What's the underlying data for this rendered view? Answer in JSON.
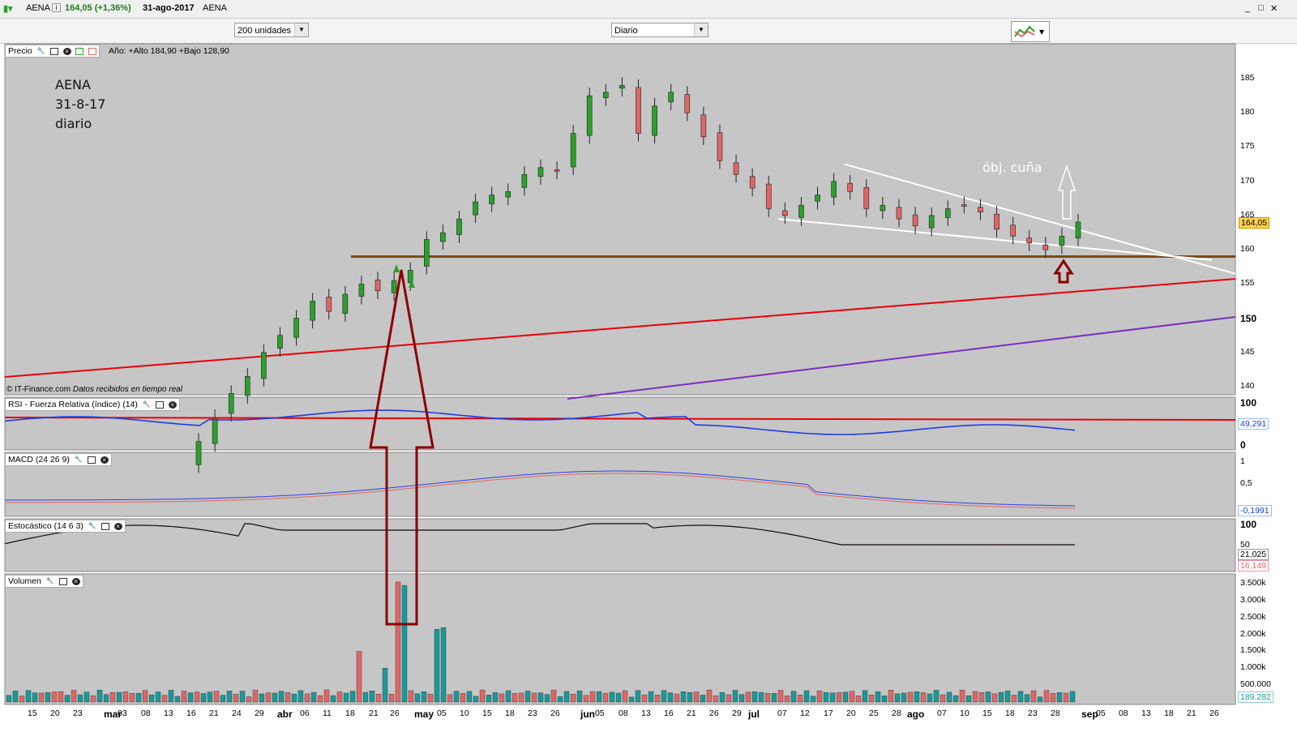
{
  "window": {
    "symbol": "AENA",
    "price_change": "164,05 (+1,36%)",
    "date": "31-ago-2017",
    "name": "AENA",
    "controls": [
      "_",
      "□",
      "✕"
    ]
  },
  "toolbar": {
    "units": "200 unidades",
    "period": "Diario"
  },
  "price_panel": {
    "label": "Precio",
    "year_info": "Año: +Alto 184,90 +Bajo 128,90",
    "last_price": "164,05",
    "credit": "© IT-Finance.com",
    "credit_note": "Datos recibidos en tiempo real",
    "ticks": [
      "185",
      "180",
      "175",
      "170",
      "165",
      "160",
      "155",
      "150",
      "145",
      "140"
    ]
  },
  "annotations": {
    "line1": "AENA",
    "line2": "31-8-17",
    "line3": "diario",
    "wedge_target": "óbj. cuña"
  },
  "rsi_panel": {
    "label": "RSI - Fuerza Relativa (índice) (14)",
    "value": "49,291",
    "ticks": [
      "100",
      "0"
    ]
  },
  "macd_panel": {
    "label": "MACD (24 26 9)",
    "value": "-0,1991",
    "ticks": [
      "1",
      "0,5"
    ]
  },
  "stoch_panel": {
    "label": "Estocástico (14 6 3)",
    "value_k": "21,025",
    "value_d": "16,149",
    "ticks": [
      "100",
      "50"
    ]
  },
  "volume_panel": {
    "label": "Volumen",
    "value": "189.282",
    "ticks": [
      "3.500k",
      "3.000k",
      "2.500k",
      "2.000k",
      "1.500k",
      "1.000k",
      "500.000"
    ]
  },
  "x_axis": {
    "labels": [
      "15",
      "20",
      "23",
      "mar",
      "03",
      "08",
      "13",
      "16",
      "21",
      "24",
      "29",
      "abr",
      "06",
      "11",
      "18",
      "21",
      "26",
      "may",
      "05",
      "10",
      "15",
      "18",
      "23",
      "26",
      "jun",
      "05",
      "08",
      "13",
      "16",
      "21",
      "26",
      "29",
      "jul",
      "07",
      "12",
      "17",
      "20",
      "25",
      "28",
      "ago",
      "07",
      "10",
      "15",
      "18",
      "23",
      "28",
      "sep",
      "05",
      "08",
      "13",
      "18",
      "21",
      "26"
    ]
  },
  "colors": {
    "up": "#2ca02c",
    "down": "#e06666",
    "support": "#7a4a14",
    "trend_red": "#e8000b",
    "trend_purple": "#7b2fbf",
    "rsi": "#1f3ee0",
    "volume_up": "#1a9999",
    "volume_down": "#e06666",
    "arrow": "#8b0000"
  },
  "chart_data": {
    "type": "candlestick",
    "title": "AENA",
    "y_range": [
      138,
      188
    ],
    "close_start": 128.9,
    "close_end": 164.05,
    "series": [
      {
        "name": "Precio",
        "values": [
          128.9,
          132.0,
          135.5,
          139.0,
          141.5,
          145.0,
          147.5,
          150.0,
          152.5,
          151.0,
          153.5,
          155.0,
          154.0,
          155.5,
          157.0,
          161.5,
          162.5,
          164.5,
          167.0,
          168.0,
          168.5,
          171.0,
          172.0,
          171.5,
          177.0,
          182.5,
          183.0,
          184.0,
          177.0,
          181.0,
          183.0,
          180.0,
          176.5,
          173.0,
          171.0,
          169.0,
          166.0,
          165.0,
          166.5,
          168.0,
          170.0,
          168.5,
          166.0,
          166.5,
          164.5,
          163.5,
          165.0,
          166.0,
          166.5,
          165.5,
          163.0,
          162.0,
          161.0,
          160.0,
          162.0,
          164.05
        ]
      }
    ],
    "rsi_value": 49.291,
    "macd_value": -0.1991,
    "stochastic": {
      "k": 21.025,
      "d": 16.149
    },
    "volume_last": 189282
  }
}
